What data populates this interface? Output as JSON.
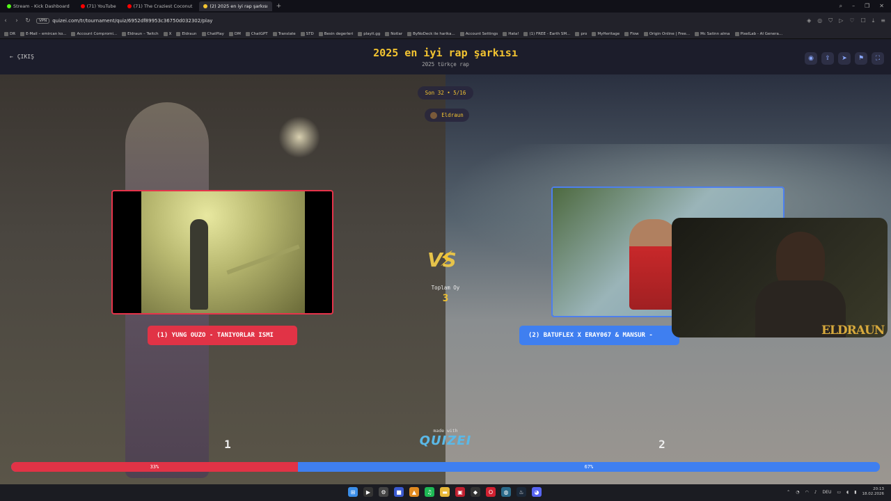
{
  "browser": {
    "tabs": [
      {
        "label": "Stream - Kick Dashboard",
        "color": "#53fc18"
      },
      {
        "label": "(71) YouTube",
        "color": "#ff0000"
      },
      {
        "label": "(71) The Craziest Coconut",
        "color": "#ff0000"
      },
      {
        "label": "(2) 2025 en iyi rap şarkısı",
        "color": "#f3c431",
        "active": true
      }
    ],
    "url": "quizei.com/tr/tournament/quiz/6952df89953c36750d032302/play",
    "vpn": "VPN",
    "bookmarks": [
      "DR",
      "E-Mail – emircan ko...",
      "Account Compromi...",
      "Eldraun – Twitch",
      "X",
      "Eldraun",
      "ChatPlay",
      "DM",
      "ChatGPT",
      "Translate",
      "STD",
      "Besin degerleri",
      "playit.gg",
      "Notlar",
      "ByNoDeck ile harika...",
      "Account Settings",
      "Hata!",
      "(1) FREE - Earth SM...",
      "pro",
      "MyHeritage",
      "Flow",
      "Origin Online | Free...",
      "Mc Satinn alma",
      "PixelLab - AI Genera..."
    ]
  },
  "header": {
    "back_label": "ÇIKIŞ",
    "title": "2025 en iyi rap şarkısı",
    "subtitle": "2025 türkçe rap",
    "icons": [
      "eye-icon",
      "share-icon",
      "send-icon",
      "flag-icon",
      "fullscreen-icon"
    ]
  },
  "round": {
    "label": "Son 32 • 5/16",
    "host": "Eldraun"
  },
  "matchup": {
    "left": {
      "label": "(1) YUNG OUZO - TANIYORLAR ISMI",
      "number": "1",
      "percent": "33%",
      "share": 0.33
    },
    "right": {
      "label": "(2) BATUFLEX X ERAY067 & MANSUR -",
      "number": "2",
      "percent": "67%"
    },
    "vs": "VS",
    "total_label": "Toplam Oy",
    "total_value": "3"
  },
  "branding": {
    "made_with": "made with",
    "logo": "QUIZEI"
  },
  "overlay": {
    "watermark": "ELDRAUN"
  },
  "taskbar": {
    "lang": "DEU",
    "time": "20:13",
    "date": "18.02.2026"
  }
}
